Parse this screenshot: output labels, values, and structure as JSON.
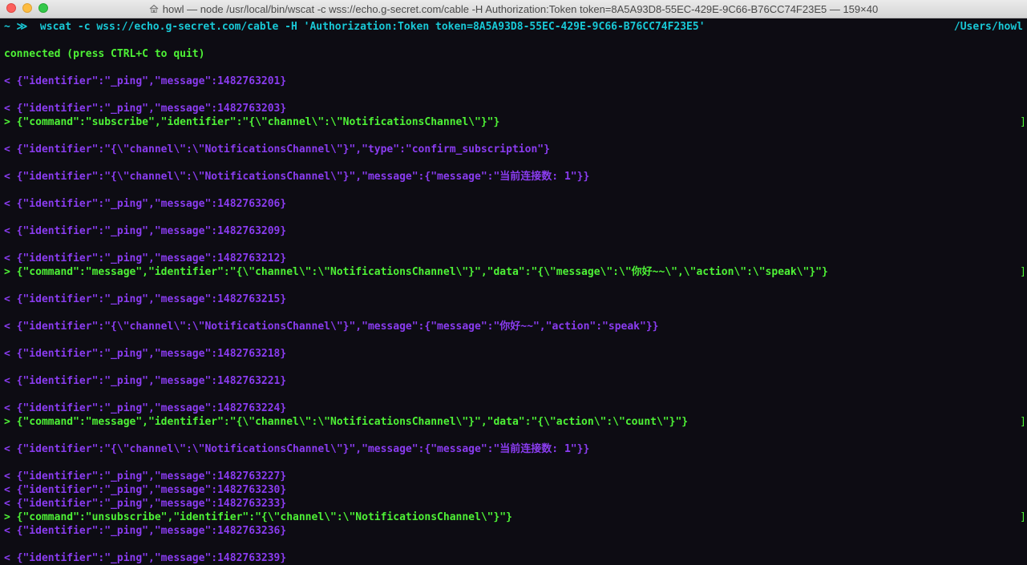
{
  "window": {
    "title": "howl — node /usr/local/bin/wscat -c wss://echo.g-secret.com/cable -H Authorization:Token token=8A5A93D8-55EC-429E-9C66-B76CC74F23E5 — 159×40"
  },
  "terminal": {
    "prompt": "~ ≫  wscat -c wss://echo.g-secret.com/cable -H 'Authorization:Token token=8A5A93D8-55EC-429E-9C66-B76CC74F23E5'",
    "cwd": "/Users/howl",
    "connected": "connected (press CTRL+C to quit)",
    "lines": [
      "< {\"identifier\":\"_ping\",\"message\":1482763201}",
      "< {\"identifier\":\"_ping\",\"message\":1482763203}",
      "> {\"command\":\"subscribe\",\"identifier\":\"{\\\"channel\\\":\\\"NotificationsChannel\\\"}\"}",
      "< {\"identifier\":\"{\\\"channel\\\":\\\"NotificationsChannel\\\"}\",\"type\":\"confirm_subscription\"}",
      "< {\"identifier\":\"{\\\"channel\\\":\\\"NotificationsChannel\\\"}\",\"message\":{\"message\":\"当前连接数: 1\"}}",
      "< {\"identifier\":\"_ping\",\"message\":1482763206}",
      "< {\"identifier\":\"_ping\",\"message\":1482763209}",
      "< {\"identifier\":\"_ping\",\"message\":1482763212}",
      "> {\"command\":\"message\",\"identifier\":\"{\\\"channel\\\":\\\"NotificationsChannel\\\"}\",\"data\":\"{\\\"message\\\":\\\"你好~~\\\",\\\"action\\\":\\\"speak\\\"}\"}",
      "< {\"identifier\":\"_ping\",\"message\":1482763215}",
      "< {\"identifier\":\"{\\\"channel\\\":\\\"NotificationsChannel\\\"}\",\"message\":{\"message\":\"你好~~\",\"action\":\"speak\"}}",
      "< {\"identifier\":\"_ping\",\"message\":1482763218}",
      "< {\"identifier\":\"_ping\",\"message\":1482763221}",
      "< {\"identifier\":\"_ping\",\"message\":1482763224}",
      "> {\"command\":\"message\",\"identifier\":\"{\\\"channel\\\":\\\"NotificationsChannel\\\"}\",\"data\":\"{\\\"action\\\":\\\"count\\\"}\"}",
      "< {\"identifier\":\"{\\\"channel\\\":\\\"NotificationsChannel\\\"}\",\"message\":{\"message\":\"当前连接数: 1\"}}",
      "< {\"identifier\":\"_ping\",\"message\":1482763227}",
      "< {\"identifier\":\"_ping\",\"message\":1482763230}",
      "< {\"identifier\":\"_ping\",\"message\":1482763233}",
      "> {\"command\":\"unsubscribe\",\"identifier\":\"{\\\"channel\\\":\\\"NotificationsChannel\\\"}\"}",
      "< {\"identifier\":\"_ping\",\"message\":1482763236}",
      "< {\"identifier\":\"_ping\",\"message\":1482763239}"
    ]
  },
  "colors": {
    "background": "#0d0c13",
    "prompt": "#19c8d6",
    "sent": "#4ef236",
    "received": "#8a3cf0"
  },
  "icons": {
    "title": "home-folder-icon"
  }
}
